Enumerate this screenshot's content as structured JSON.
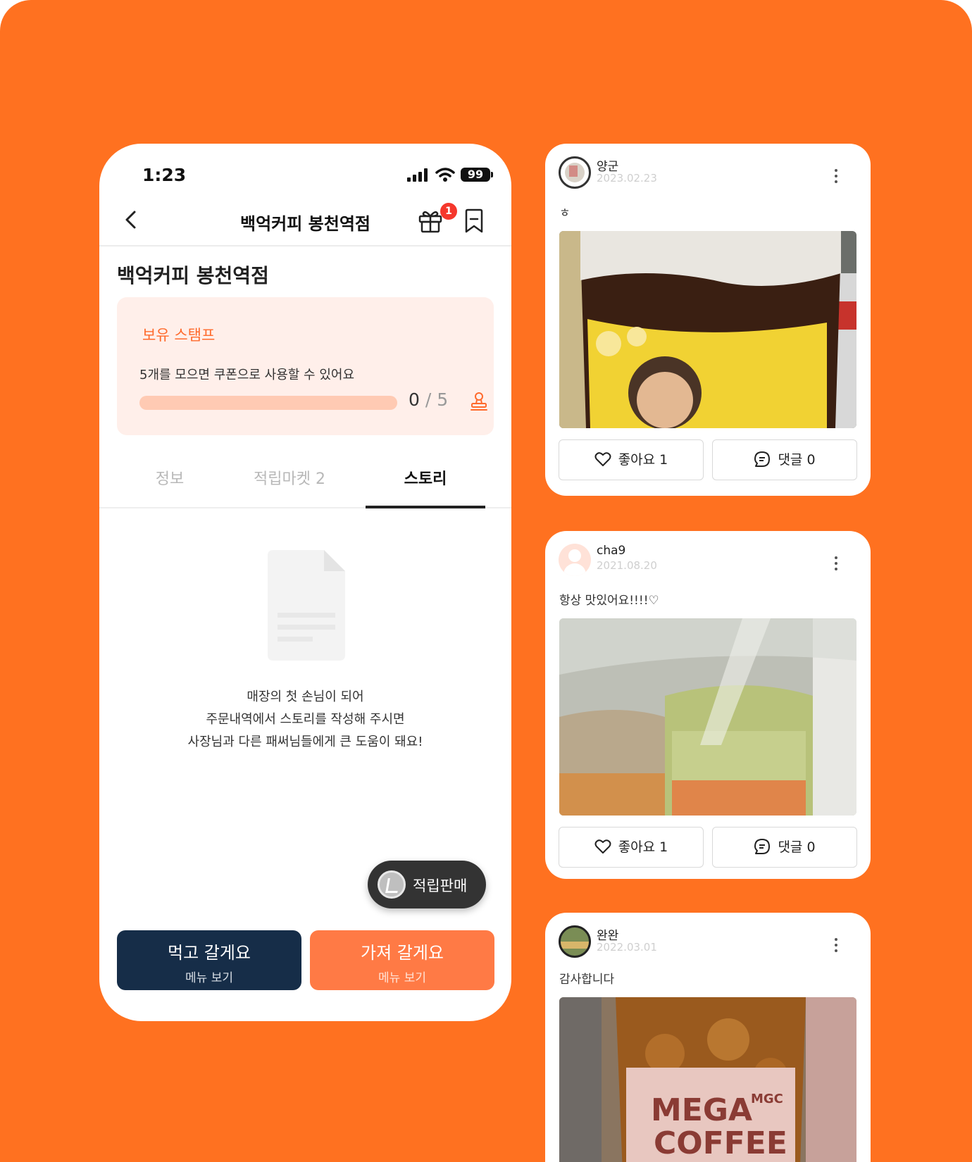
{
  "phone": {
    "status": {
      "time": "1:23",
      "battery": "99"
    },
    "nav": {
      "title": "백억커피 봉천역점",
      "gift_badge": "1"
    },
    "store_name": "백억커피 봉천역점",
    "stamp": {
      "label": "보유 스탬프",
      "description": "5개를 모으면 쿠폰으로 사용할 수 있어요",
      "current": "0",
      "separator": "/",
      "total": "5",
      "progress_fraction": 0
    },
    "tabs": [
      {
        "label": "정보",
        "active": false
      },
      {
        "label": "적립마켓 2",
        "active": false
      },
      {
        "label": "스토리",
        "active": true
      }
    ],
    "empty_state": {
      "line1": "매장의 첫 손님이 되어",
      "line2": "주문내역에서 스토리를 작성해 주시면",
      "line3": "사장님과 다른 패써님들에게 큰 도움이 돼요!"
    },
    "fab_label": "적립판매",
    "buttons": {
      "dine_in": {
        "main": "먹고 갈게요",
        "sub": "메뉴 보기"
      },
      "takeout": {
        "main": "가져 갈게요",
        "sub": "메뉴 보기"
      }
    }
  },
  "stories": [
    {
      "user": "양군",
      "date": "2023.02.23",
      "text": "ㅎ",
      "like_label": "좋아요 1",
      "comment_label": "댓글 0"
    },
    {
      "user": "cha9",
      "date": "2021.08.20",
      "text": "항상 맛있어요!!!!♡",
      "like_label": "좋아요 1",
      "comment_label": "댓글 0"
    },
    {
      "user": "완완",
      "date": "2022.03.01",
      "text": "감사합니다",
      "photo_text_1": "MEGA",
      "photo_text_2": "COFFEE",
      "photo_text_3": "MGC"
    }
  ],
  "colors": {
    "background": "#FF7120",
    "accent": "#FF6A2C",
    "dark_button": "#162D48",
    "takeout_button": "#FF7A45"
  }
}
